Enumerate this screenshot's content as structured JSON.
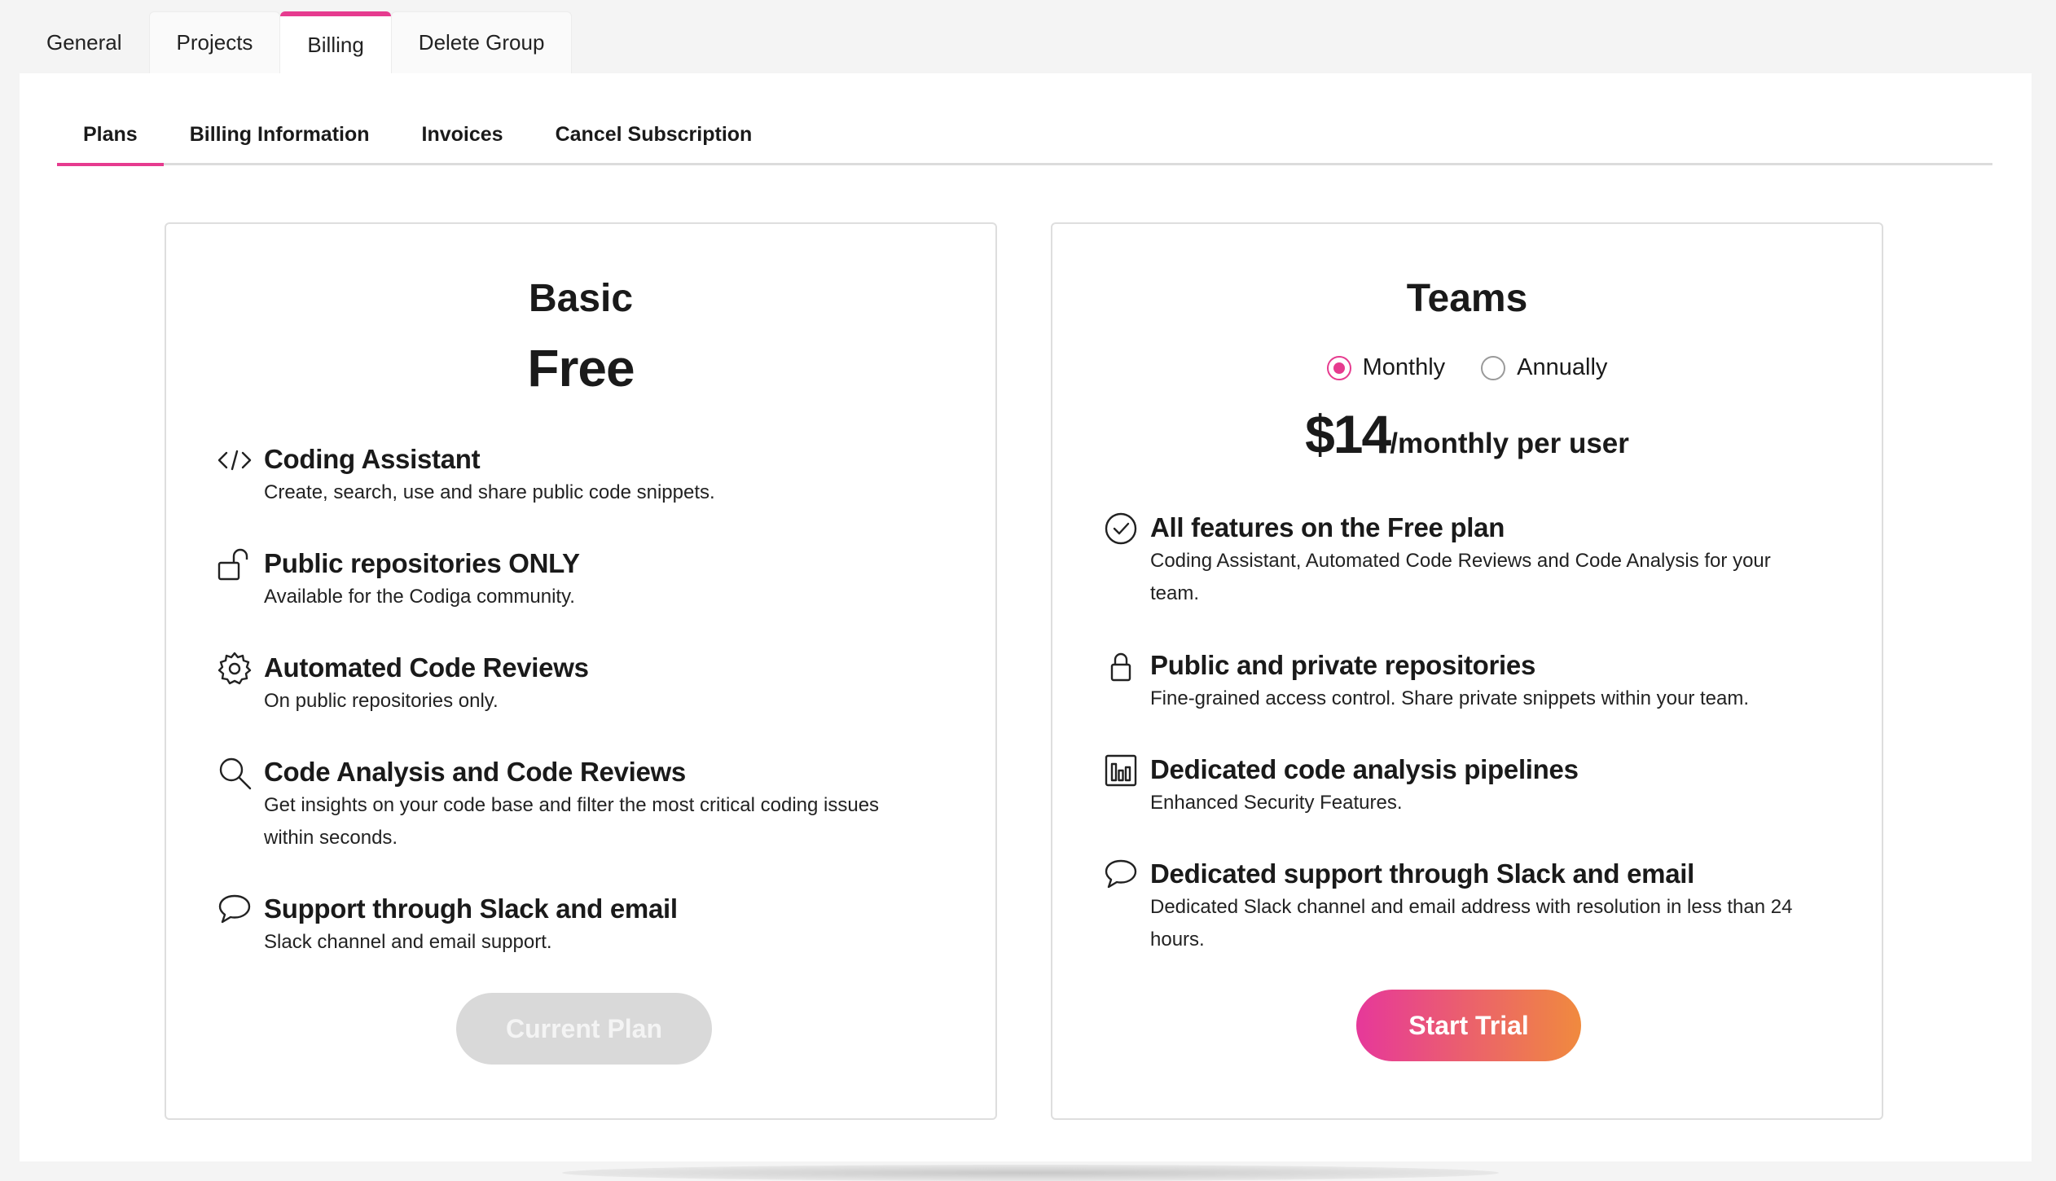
{
  "top_tabs": [
    "General",
    "Projects",
    "Billing",
    "Delete Group"
  ],
  "sub_tabs": [
    "Plans",
    "Billing Information",
    "Invoices",
    "Cancel Subscription"
  ],
  "colors": {
    "accent": "#e63b8f",
    "gradient_start": "#e6389a",
    "gradient_end": "#f08a3e"
  },
  "basic": {
    "title": "Basic",
    "price": "Free",
    "features": [
      {
        "icon": "code-icon",
        "title": "Coding Assistant",
        "desc": "Create, search, use and share public code snippets."
      },
      {
        "icon": "unlock-icon",
        "title": "Public repositories ONLY",
        "desc": "Available for the Codiga community."
      },
      {
        "icon": "gear-icon",
        "title": "Automated Code Reviews",
        "desc": "On public repositories only."
      },
      {
        "icon": "search-icon",
        "title": "Code Analysis and Code Reviews",
        "desc": "Get insights on your code base and filter the most critical coding issues within seconds."
      },
      {
        "icon": "chat-icon",
        "title": "Support through Slack and email",
        "desc": "Slack channel and email support."
      }
    ],
    "button": "Current Plan"
  },
  "teams": {
    "title": "Teams",
    "billing_options": [
      "Monthly",
      "Annually"
    ],
    "selected_option": "Monthly",
    "price": "$14",
    "price_unit": "/monthly per user",
    "features": [
      {
        "icon": "check-circle-icon",
        "title": "All features on the Free plan",
        "desc": "Coding Assistant, Automated Code Reviews and Code Analysis for your team."
      },
      {
        "icon": "lock-icon",
        "title": "Public and private repositories",
        "desc": "Fine-grained access control. Share private snippets within your team."
      },
      {
        "icon": "bar-chart-icon",
        "title": "Dedicated code analysis pipelines",
        "desc": "Enhanced Security Features."
      },
      {
        "icon": "chat-icon",
        "title": "Dedicated support through Slack and email",
        "desc": "Dedicated Slack channel and email address with resolution in less than 24 hours."
      }
    ],
    "button": "Start Trial"
  }
}
